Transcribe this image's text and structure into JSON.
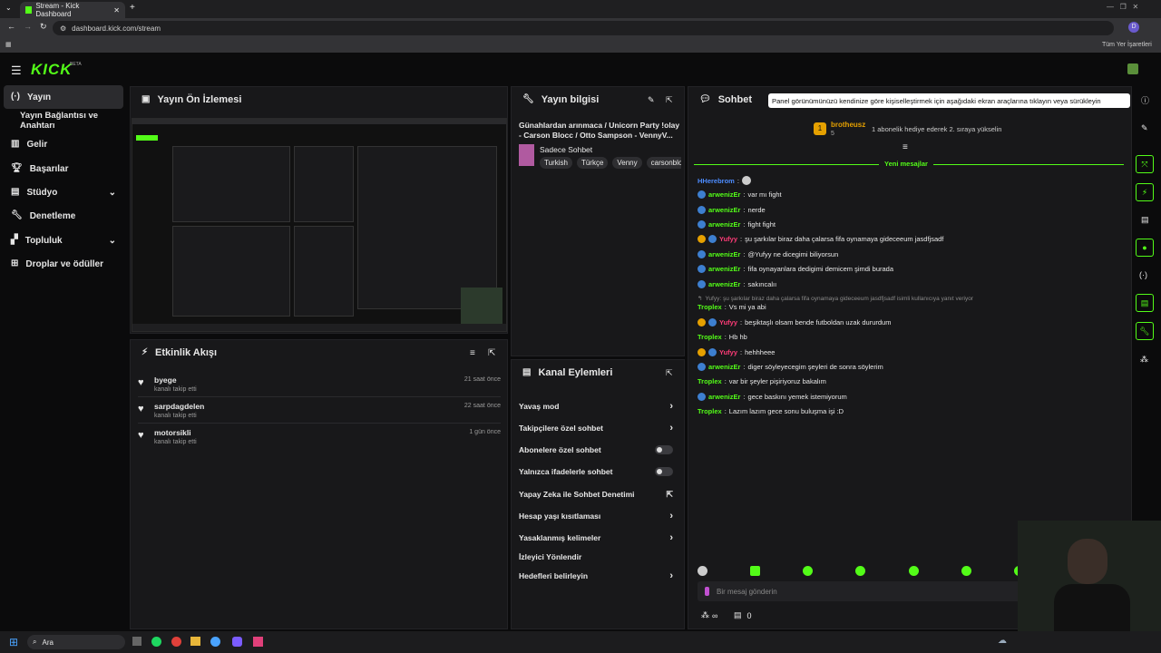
{
  "browser": {
    "tab_title": "Stream - Kick Dashboard",
    "url": "dashboard.kick.com/stream",
    "bookmarks_label": "Tüm Yer İşaretleri",
    "profile": "D"
  },
  "app": {
    "logo": "KICK",
    "logo_sup": "BETA",
    "accent": "#53fc18"
  },
  "sidebar": {
    "items": [
      {
        "label": "Yayın",
        "icon": "broadcast-icon"
      },
      {
        "label": "Yayın Bağlantısı ve Anahtarı",
        "icon": ""
      },
      {
        "label": "Gelir",
        "icon": "revenue-icon"
      },
      {
        "label": "Başarılar",
        "icon": "trophy-icon"
      },
      {
        "label": "Stüdyo",
        "icon": "studio-icon"
      },
      {
        "label": "Denetleme",
        "icon": "wrench-icon"
      },
      {
        "label": "Topluluk",
        "icon": "community-icon"
      },
      {
        "label": "Droplar ve ödüller",
        "icon": "gift-icon"
      }
    ]
  },
  "preview": {
    "title": "Yayın Ön İzlemesi"
  },
  "info": {
    "title": "Yayın bilgisi",
    "stream_title": "Günahlardan arınmaca / Unicorn Party !olay - Carson Blocc / Otto Sampson - VennyV...",
    "category": "Sadece Sohbet",
    "tags": [
      "Turkish",
      "Türkçe",
      "Venny",
      "carsonblo"
    ]
  },
  "activity": {
    "title": "Etkinlik Akışı",
    "items": [
      {
        "user": "byege",
        "action": "kanalı takip etti",
        "time": "21 saat önce"
      },
      {
        "user": "sarpdagdelen",
        "action": "kanalı takip etti",
        "time": "22 saat önce"
      },
      {
        "user": "motorsikli",
        "action": "kanalı takip etti",
        "time": "1 gün önce"
      }
    ]
  },
  "actions": {
    "title": "Kanal Eylemleri",
    "items": [
      {
        "label": "Yavaş mod",
        "type": "chevron"
      },
      {
        "label": "Takipçilere özel sohbet",
        "type": "chevron"
      },
      {
        "label": "Abonelere özel sohbet",
        "type": "toggle"
      },
      {
        "label": "Yalnızca ifadelerle sohbet",
        "type": "toggle"
      },
      {
        "label": "Yapay Zeka ile Sohbet Denetimi",
        "type": "external"
      },
      {
        "label": "Hesap yaşı kısıtlaması",
        "type": "chevron"
      },
      {
        "label": "Yasaklanmış kelimeler",
        "type": "chevron"
      },
      {
        "label": "İzleyici Yönlendir",
        "type": "none"
      },
      {
        "label": "Hedefleri belirleyin",
        "type": "chevron"
      }
    ]
  },
  "chat": {
    "title": "Sohbet",
    "tooltip": "Panel görünümünüzü kendinize göre kişiselleştirmek için aşağıdaki ekran araçlarına tıklayın veya sürükleyin",
    "pinned": {
      "user": "brotheusz",
      "count": "5",
      "text": "1 abonelik hediye ederek 2. sıraya yükselin"
    },
    "new_label": "Yeni mesajlar",
    "messages": [
      {
        "user": "HHerebrom",
        "text": "",
        "color": "#4d8cff",
        "badge": "none"
      },
      {
        "user": "arwenizEr",
        "text": "var mı fight",
        "color": "#53fc18",
        "badge": "blue"
      },
      {
        "user": "arwenizEr",
        "text": "nerde",
        "color": "#53fc18",
        "badge": "blue"
      },
      {
        "user": "arwenizEr",
        "text": "fight fight",
        "color": "#53fc18",
        "badge": "blue"
      },
      {
        "user": "Yufyy",
        "text": "şu şarkılar biraz daha çalarsa fifa oynamaya gideceeum jasdfjsadf",
        "color": "#ff3c78",
        "badge": "gold"
      },
      {
        "user": "arwenizEr",
        "text": "@Yufyy ne dicegimi biliyorsun",
        "color": "#53fc18",
        "badge": "blue"
      },
      {
        "user": "arwenizEr",
        "text": "fifa oynayanlara dedigimi demicem şimdi burada",
        "color": "#53fc18",
        "badge": "blue"
      },
      {
        "user": "arwenizEr",
        "text": "sakıncalıı",
        "color": "#53fc18",
        "badge": "blue"
      },
      {
        "user": "",
        "text": "Yufyy: şu şarkılar biraz daha çalarsa fifa oynamaya gideceeum jasdfjsadf isimli kullanıcıya yanıt veriyor",
        "color": "#8a8a8a",
        "badge": "reply"
      },
      {
        "user": "Troplex",
        "text": "Vs mi ya abi",
        "color": "#53fc18",
        "badge": "none"
      },
      {
        "user": "Yufyy",
        "text": "beşiktaşlı olsam bende futboldan uzak dururdum",
        "color": "#ff3c78",
        "badge": "gold"
      },
      {
        "user": "Troplex",
        "text": "Hb hb",
        "color": "#53fc18",
        "badge": "none"
      },
      {
        "user": "Yufyy",
        "text": "hehhheee",
        "color": "#ff3c78",
        "badge": "gold"
      },
      {
        "user": "arwenizEr",
        "text": "diger söyleyecegim şeyleri de sonra söylerim",
        "color": "#53fc18",
        "badge": "blue"
      },
      {
        "user": "Troplex",
        "text": "var bir şeyler pişiriyoruz bakalım",
        "color": "#53fc18",
        "badge": "none"
      },
      {
        "user": "arwenizEr",
        "text": "gece baskını yemek istemiyorum",
        "color": "#53fc18",
        "badge": "blue"
      },
      {
        "user": "Troplex",
        "text": "Lazım lazım gece sonu buluşma işi :D",
        "color": "#53fc18",
        "badge": "none"
      }
    ],
    "input_placeholder": "Bir mesaj gönderin",
    "bottom_left": "∞",
    "bottom_count": "0"
  },
  "taskbar": {
    "search": "Ara"
  }
}
